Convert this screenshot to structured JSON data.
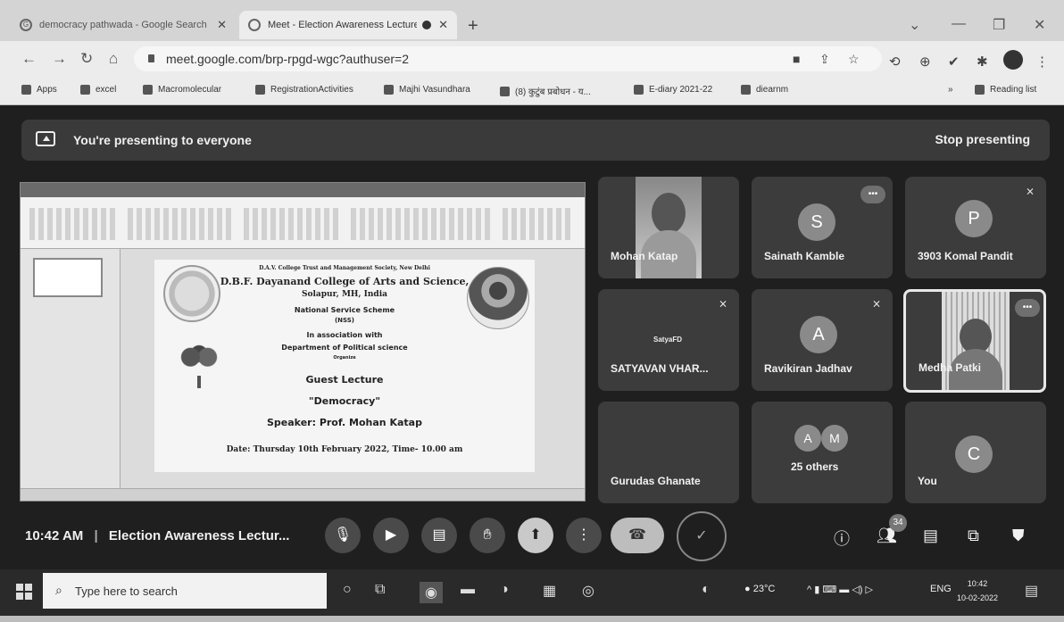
{
  "browser": {
    "tabs": [
      {
        "title": "democracy pathwada - Google Search",
        "icon": "google-g-icon",
        "active": false
      },
      {
        "title": "Meet - Election Awareness Lecture",
        "icon": "meet-icon",
        "active": true
      }
    ],
    "url": "meet.google.com/brp-rpgd-wgc?authuser=2",
    "bookmarks": [
      {
        "label": "Apps"
      },
      {
        "label": "excel"
      },
      {
        "label": "Macromolecular"
      },
      {
        "label": "RegistrationActivities"
      },
      {
        "label": "Majhi Vasundhara"
      },
      {
        "label": "(8) कुटुंब प्रबोधन - य..."
      },
      {
        "label": "E-diary 2021-22"
      },
      {
        "label": "diearnm"
      }
    ],
    "reading_list": "Reading list"
  },
  "meet": {
    "banner_text": "You're presenting to everyone",
    "stop_presenting": "Stop presenting",
    "slide": {
      "line1": "D.A.V. College Trust and Management Society, New Delhi",
      "line2": "D.B.F. Dayanand College of Arts and Science,",
      "line3": "Solapur, MH, India",
      "line4": "National Service Scheme",
      "line5": "(NSS)",
      "line6": "In association with",
      "line7": "Department of Political science",
      "line8": "Organize",
      "line9": "Guest Lecture",
      "line10": "\"Democracy\"",
      "line11": "Speaker: Prof. Mohan Katap",
      "line12": "Date: Thursday 10th February 2022, Time- 10.00 am"
    },
    "participants": [
      {
        "name": "Mohan Katap",
        "type": "video"
      },
      {
        "name": "Sainath Kamble",
        "initial": "S"
      },
      {
        "name": "3903 Komal Pandit",
        "initial": "P"
      },
      {
        "name": "SATYAVAN VHAR..."
      },
      {
        "name": "Ravikiran Jadhav",
        "initial": "A"
      },
      {
        "name": "Medha Patki",
        "type": "video"
      },
      {
        "name": "Gurudas Ghanate"
      },
      {
        "name": "25 others",
        "initials": [
          "A",
          "M"
        ]
      },
      {
        "name": "You",
        "initial": "C"
      }
    ],
    "time": "10:42 AM",
    "meeting_title": "Election Awareness Lectur...",
    "people_count": "34"
  },
  "taskbar": {
    "search_placeholder": "Type here to search",
    "temperature": "23°C",
    "language": "ENG",
    "time": "10:42",
    "date": "10-02-2022"
  }
}
